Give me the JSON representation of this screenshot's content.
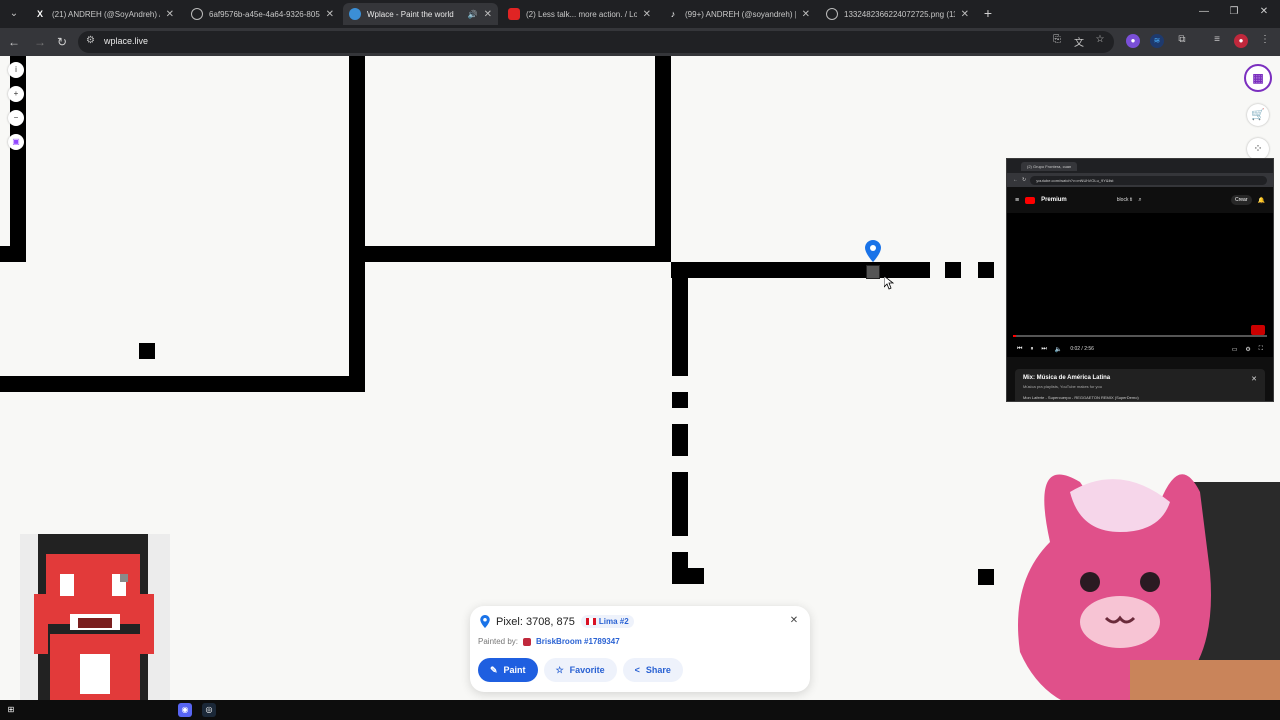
{
  "browser": {
    "tabs": [
      {
        "title": "(21) ANDREH (@SoyAndreh) / X",
        "icon": "x-logo-icon",
        "active": false
      },
      {
        "title": "6af9576b-a45e-4a64-9326-805",
        "icon": "globe-icon",
        "active": false
      },
      {
        "title": "Wplace - Paint the world",
        "icon": "wplace-icon",
        "active": true
      },
      {
        "title": "(2) Less talk... more action. / Lo",
        "icon": "youtube-icon",
        "active": false
      },
      {
        "title": "(99+) ANDREH (@soyandreh) | T",
        "icon": "tiktok-icon",
        "active": false
      },
      {
        "title": "1332482366224072725.png (11",
        "icon": "globe-icon",
        "active": false
      }
    ],
    "url": "wplace.live"
  },
  "youtube": {
    "tab_title": "(2) Grupo Frontera, cuan",
    "url": "youtube.com/watch?v=mNUhVOLu_9Y&list",
    "brand": "Premium",
    "search_text": "block ti",
    "create_label": "Crear",
    "time": "0:02 / 2:56",
    "progress": 0.01,
    "mix_title": "Mix: Música de América Latina",
    "mix_subtitle": "Música pra playlists, YouTube makes for you",
    "mix_next": "Mon Laferte - Supercuerpo - REGGAETON REMIX (SuperDemo)"
  },
  "pixel_panel": {
    "coords": "Pixel: 3708, 875",
    "region": "Lima #2",
    "painted_by_label": "Painted by:",
    "painter": "BriskBroom #1789347",
    "paint_label": "Paint",
    "favorite_label": "Favorite",
    "share_label": "Share"
  },
  "colors": {
    "accent": "#1f5fe0",
    "link": "#2a62d3",
    "canvas": "#f8f8f6",
    "pixel": "#000000",
    "pin": "#1a73e8"
  }
}
